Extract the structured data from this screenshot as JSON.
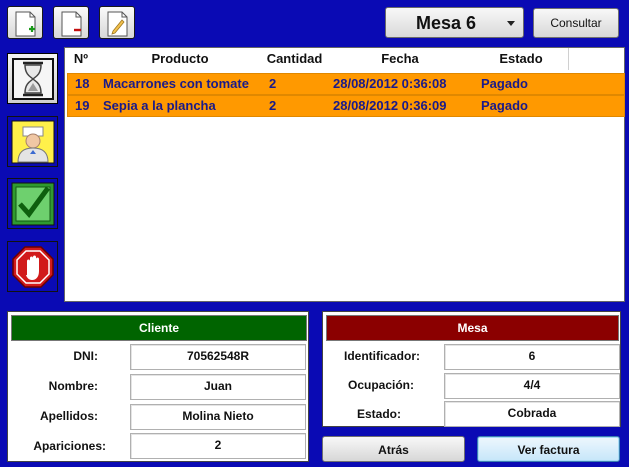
{
  "toolbar": {
    "table_selector": "Mesa 6",
    "consult_label": "Consultar"
  },
  "grid": {
    "columns": [
      "Nº",
      "Producto",
      "Cantidad",
      "Fecha",
      "Estado"
    ],
    "rows": [
      {
        "num": "18",
        "producto": "Macarrones con tomate",
        "cantidad": "2",
        "fecha": "28/08/2012 0:36:08",
        "estado": "Pagado"
      },
      {
        "num": "19",
        "producto": "Sepia a la plancha",
        "cantidad": "2",
        "fecha": "28/08/2012 0:36:09",
        "estado": "Pagado"
      }
    ],
    "row_color": "#ff9900"
  },
  "cliente": {
    "title": "Cliente",
    "title_color": "#006400",
    "dni_label": "DNI:",
    "dni": "70562548R",
    "nombre_label": "Nombre:",
    "nombre": "Juan",
    "apellidos_label": "Apellidos:",
    "apellidos": "Molina Nieto",
    "apariciones_label": "Apariciones:",
    "apariciones": "2"
  },
  "mesa": {
    "title": "Mesa",
    "title_color": "#8b0000",
    "id_label": "Identificador:",
    "id": "6",
    "ocupacion_label": "Ocupación:",
    "ocupacion": "4/4",
    "estado_label": "Estado:",
    "estado": "Cobrada"
  },
  "actions": {
    "back_label": "Atrás",
    "invoice_label": "Ver factura"
  },
  "icons": [
    "new-document-icon",
    "delete-document-icon",
    "edit-document-icon",
    "hourglass-icon",
    "waiter-icon",
    "checkmark-icon",
    "stop-hand-icon"
  ]
}
